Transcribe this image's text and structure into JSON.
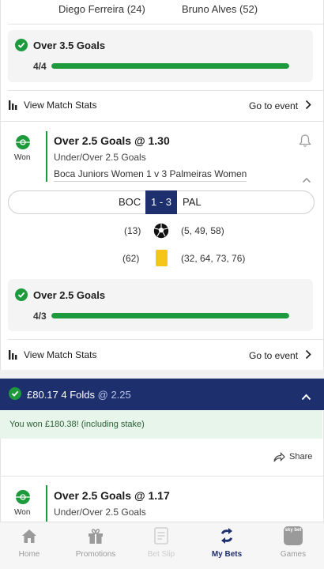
{
  "header": {
    "player_left": "Diego Ferreira (24)",
    "player_right": "Bruno Alves (52)"
  },
  "stat_top": {
    "title": "Over 3.5 Goals",
    "ratio": "4/4",
    "progress": 1.0
  },
  "stats_row_1": {
    "view_stats": "View Match Stats",
    "go_to_event": "Go to event"
  },
  "bet_1": {
    "status": "Won",
    "title": "Over 2.5 Goals @ 1.30",
    "market": "Under/Over 2.5 Goals",
    "match": "Boca Juniors Women 1 v 3 Palmeiras Women",
    "home_abbr": "BOC",
    "score": "1 - 3",
    "away_abbr": "PAL",
    "goals_home": "(13)",
    "goals_away": "(5, 49, 58)",
    "cards_home": "(62)",
    "cards_away": "(32, 64, 73, 76)"
  },
  "stat_mid": {
    "title": "Over 2.5 Goals",
    "ratio": "4/3",
    "progress": 1.0
  },
  "stats_row_2": {
    "view_stats": "View Match Stats",
    "go_to_event": "Go to event"
  },
  "accumulator": {
    "title": "£80.17 4 Folds",
    "odds": "@ 2.25",
    "won_message": "You won £180.38! (including stake)",
    "share_label": "Share"
  },
  "bet_2": {
    "status": "Won",
    "title": "Over 2.5 Goals @ 1.17",
    "market": "Under/Over 2.5 Goals"
  },
  "bottom_nav": {
    "home": "Home",
    "promotions": "Promotions",
    "bet_slip": "Bet Slip",
    "my_bets": "My Bets",
    "games": "Games",
    "games_icon_text": "sky bet"
  },
  "colors": {
    "accent_navy": "#1e2f6e",
    "success_green": "#1d9a3c"
  }
}
